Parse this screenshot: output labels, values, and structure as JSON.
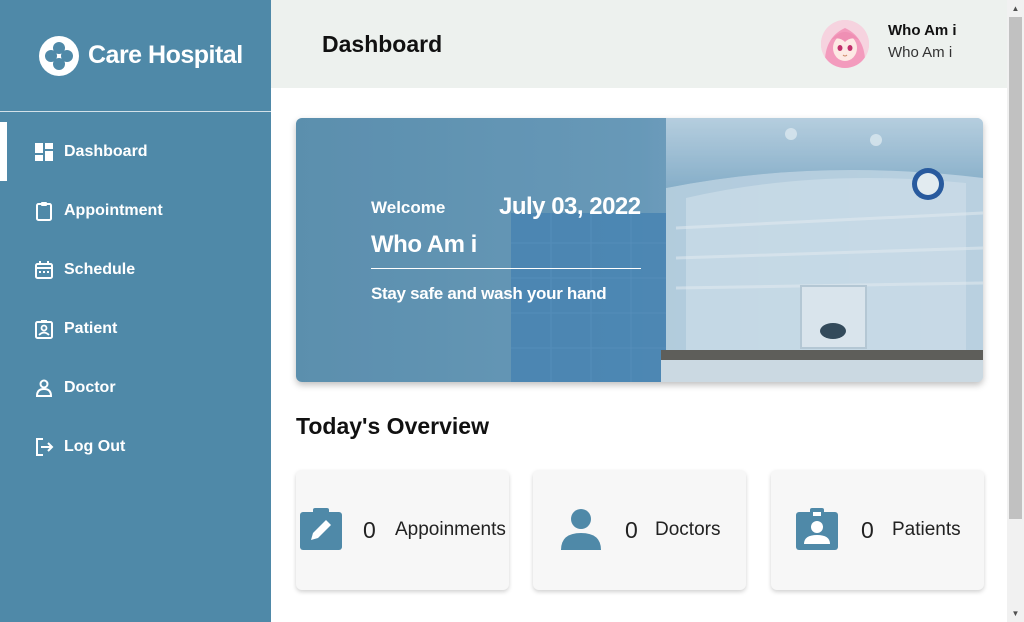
{
  "brand": {
    "name": "Care Hospital"
  },
  "sidebar": {
    "items": [
      {
        "label": "Dashboard",
        "icon": "dashboard-icon",
        "active": true
      },
      {
        "label": "Appointment",
        "icon": "clipboard-icon",
        "active": false
      },
      {
        "label": "Schedule",
        "icon": "calendar-icon",
        "active": false
      },
      {
        "label": "Patient",
        "icon": "badge-icon",
        "active": false
      },
      {
        "label": "Doctor",
        "icon": "person-icon",
        "active": false
      },
      {
        "label": "Log Out",
        "icon": "logout-icon",
        "active": false
      }
    ]
  },
  "header": {
    "title": "Dashboard",
    "user_name": "Who Am i",
    "user_role": "Who Am i"
  },
  "banner": {
    "welcome": "Welcome",
    "date": "July 03, 2022",
    "name": "Who Am i",
    "tagline": "Stay safe and wash your hand"
  },
  "overview": {
    "title": "Today's Overview",
    "cards": [
      {
        "count": "0",
        "label": "Appoinments",
        "icon": "edit-note-icon"
      },
      {
        "count": "0",
        "label": "Doctors",
        "icon": "person-icon"
      },
      {
        "count": "0",
        "label": "Patients",
        "icon": "badge-icon"
      }
    ]
  },
  "colors": {
    "sidebar": "#4f89a8",
    "header": "#edf1ee",
    "accent": "#4f89a8",
    "card": "#f7f7f7"
  }
}
